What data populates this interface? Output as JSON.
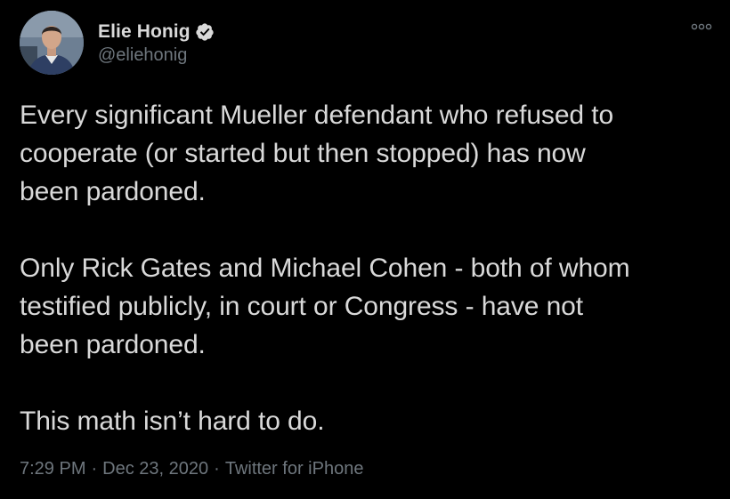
{
  "tweet": {
    "author": {
      "display_name": "Elie Honig",
      "handle": "@eliehonig",
      "verified": true,
      "avatar_icon": "profile-photo"
    },
    "more_icon": "more-options-icon",
    "paragraphs": [
      "Every significant Mueller defendant who refused to\ncooperate (or started but then stopped) has now\nbeen pardoned.",
      "Only Rick Gates and Michael Cohen - both of whom\ntestified publicly, in court or Congress - have not\nbeen pardoned.",
      "This math isn’t hard to do."
    ],
    "meta": {
      "time": "7:29 PM",
      "separator": "·",
      "date": "Dec 23, 2020",
      "source": "Twitter for iPhone"
    }
  },
  "colors": {
    "background": "#000000",
    "text": "#d9d9d9",
    "secondary_text": "#6e767d",
    "verified_badge": "#d9d9d9"
  }
}
